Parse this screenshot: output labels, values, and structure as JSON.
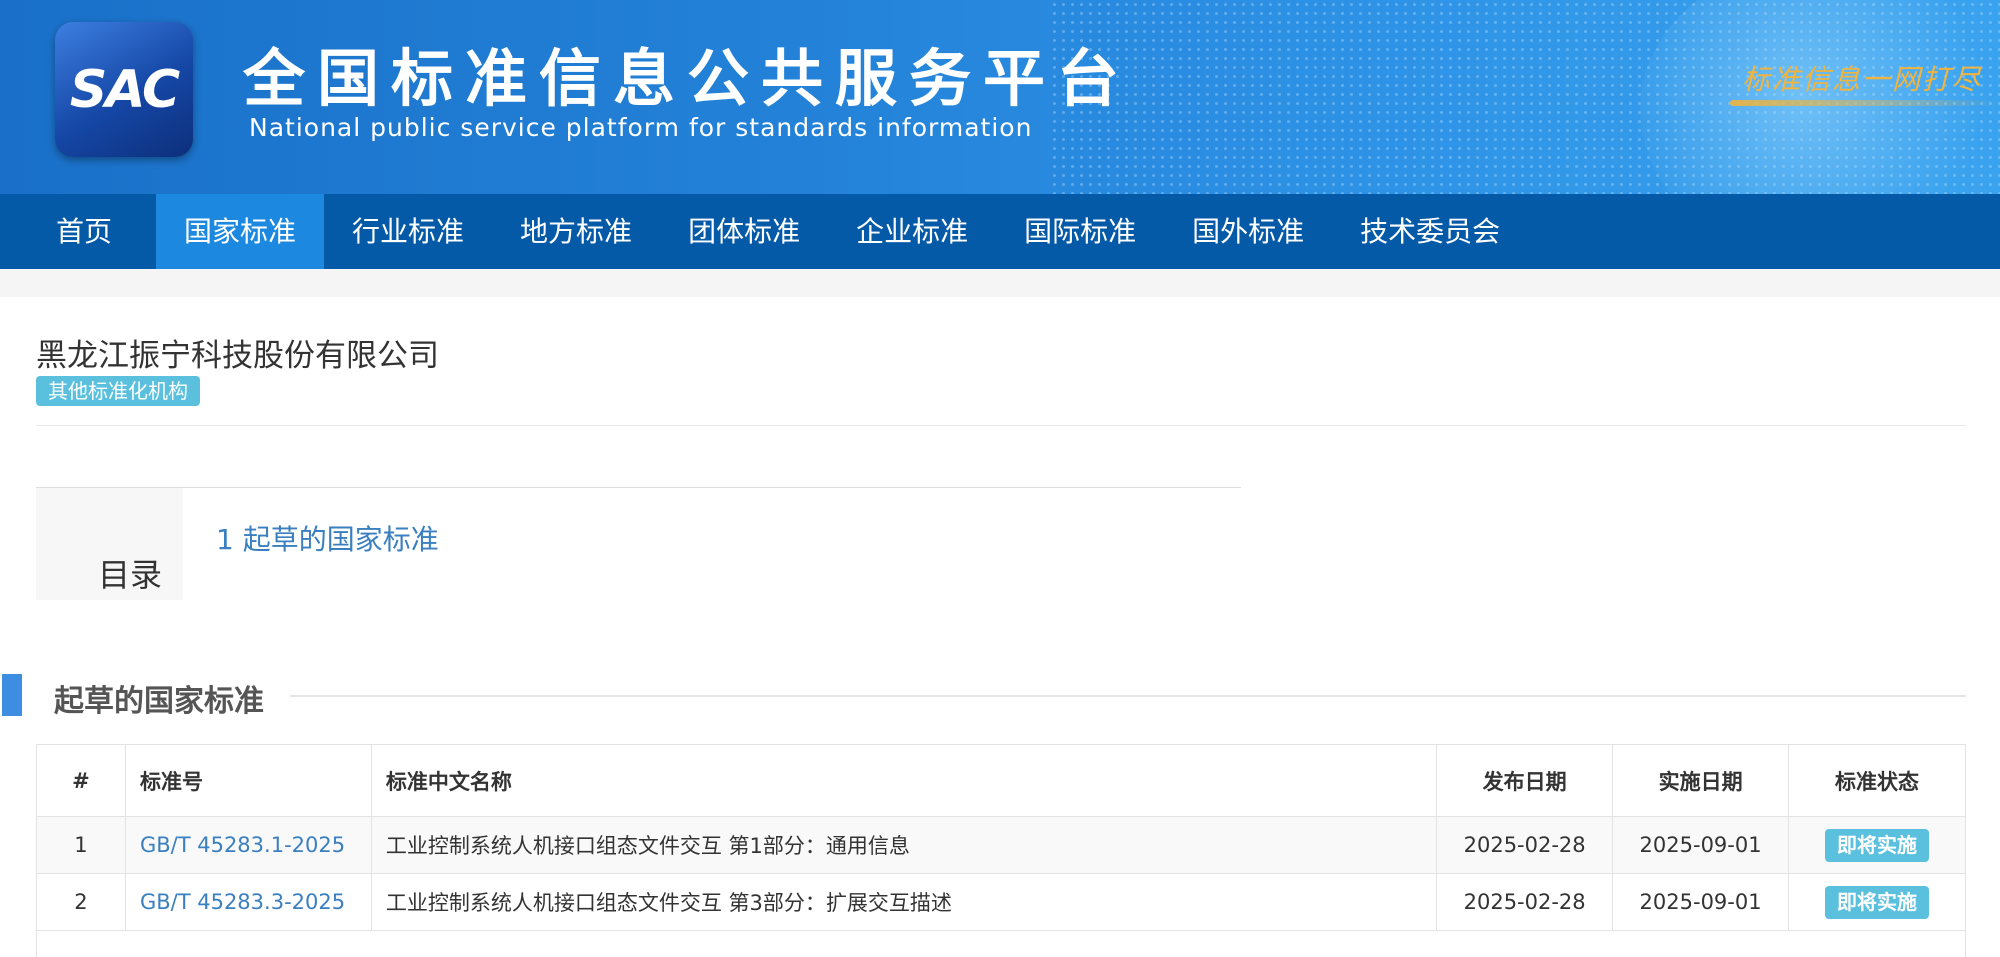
{
  "header": {
    "logo_text": "SAC",
    "title": "全国标准信息公共服务平台",
    "subtitle": "National public service platform  for standards information",
    "slogan": "标准信息一网打尽"
  },
  "nav": {
    "items": [
      {
        "label": "首页"
      },
      {
        "label": "国家标准",
        "active": true
      },
      {
        "label": "行业标准"
      },
      {
        "label": "地方标准"
      },
      {
        "label": "团体标准"
      },
      {
        "label": "企业标准"
      },
      {
        "label": "国际标准"
      },
      {
        "label": "国外标准"
      },
      {
        "label": "技术委员会"
      }
    ]
  },
  "org": {
    "name": "黑龙江振宁科技股份有限公司",
    "type_badge": "其他标准化机构"
  },
  "toc": {
    "label": "目录",
    "items": [
      {
        "label": "1  起草的国家标准"
      }
    ]
  },
  "section": {
    "title": "起草的国家标准"
  },
  "table": {
    "headers": [
      "#",
      "标准号",
      "标准中文名称",
      "发布日期",
      "实施日期",
      "标准状态"
    ],
    "rows": [
      {
        "index": "1",
        "code": "GB/T 45283.1-2025",
        "name": "工业控制系统人机接口组态文件交互 第1部分：通用信息",
        "publish": "2025-02-28",
        "implement": "2025-09-01",
        "status": "即将实施"
      },
      {
        "index": "2",
        "code": "GB/T 45283.3-2025",
        "name": "工业控制系统人机接口组态文件交互 第3部分：扩展交互描述",
        "publish": "2025-02-28",
        "implement": "2025-09-01",
        "status": "即将实施"
      }
    ]
  },
  "colors": {
    "header_blue": "#2382d8",
    "nav_blue": "#055aa8",
    "nav_active": "#1c88e0",
    "badge_cyan": "#5bc0de",
    "link_blue": "#3a7fbf"
  }
}
